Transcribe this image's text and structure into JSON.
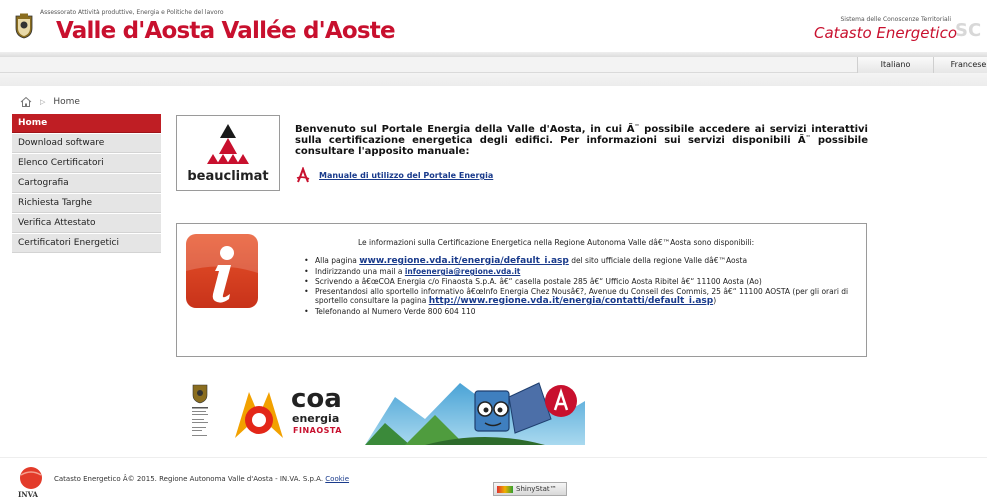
{
  "header": {
    "department": "Assessorato Attività produttive, Energia e Politiche del lavoro",
    "brand": "Valle d'Aosta Vallée d'Aoste",
    "system_label": "Sistema delle Conoscenze Territoriali",
    "system_title": "Catasto Energetico",
    "system_logo_text": "SC"
  },
  "languages": [
    "Italiano",
    "Francese"
  ],
  "breadcrumb": {
    "home": "Home",
    "icon": "home-icon"
  },
  "sidebar": {
    "items": [
      {
        "label": "Home",
        "active": true
      },
      {
        "label": "Download software",
        "active": false
      },
      {
        "label": "Elenco Certificatori",
        "active": false
      },
      {
        "label": "Cartografia",
        "active": false
      },
      {
        "label": "Richiesta Targhe",
        "active": false
      },
      {
        "label": "Verifica Attestato",
        "active": false
      },
      {
        "label": "Certificatori Energetici",
        "active": false
      }
    ]
  },
  "welcome": {
    "logo_text": "beauclimat",
    "text": "Benvenuto sul Portale Energia della Valle d'Aosta, in cui Ã¨ possibile accedere ai servizi interattivi sulla certificazione energetica degli edifici. Per informazioni sui servizi disponibili Ã¨ possibile consultare l'apposito manuale:",
    "manual_link": "Manuale di utilizzo del Portale Energia"
  },
  "info": {
    "intro": "Le informazioni sulla Certificazione Energetica nella Regione Autonoma Valle dâ€™Aosta sono disponibili:",
    "items": {
      "i0_pre": "Alla pagina ",
      "i0_link": "www.regione.vda.it/energia/default_i.asp",
      "i0_post": " del sito ufficiale della regione Valle dâ€™Aosta",
      "i1_pre": "Indirizzando una mail a ",
      "i1_link": "infoenergia@regione.vda.it",
      "i2": "Scrivendo a â€œCOA Energia c/o Finaosta S.p.A. â€“ casella postale 285 â€“ Ufficio Aosta Ribitel â€“ 11100 Aosta (Ao)",
      "i3_pre": "Presentandosi allo sportello informativo â€œInfo Energia Chez Nousâ€?, Avenue du Conseil des Commis, 25 â€“ 11100 AOSTA (per gli orari di sportello consultare la pagina ",
      "i3_link": "http://www.regione.vda.it/energia/contatti/default_i.asp",
      "i3_post": ")",
      "i4": "Telefonando al Numero Verde 800 604 110"
    }
  },
  "partners": {
    "coa_line1": "coa",
    "coa_line2": "energia",
    "coa_line3": "FINAOSTA"
  },
  "footer": {
    "inva": "INVA",
    "text": "Catasto Energetico Â© 2015. Regione Autonoma Valle d'Aosta - IN.VA. S.p.A. ",
    "cookie": "Cookie",
    "shinystat": "ShinyStat™"
  },
  "colors": {
    "accent": "#bf1e24",
    "link": "#1a3b8c"
  }
}
